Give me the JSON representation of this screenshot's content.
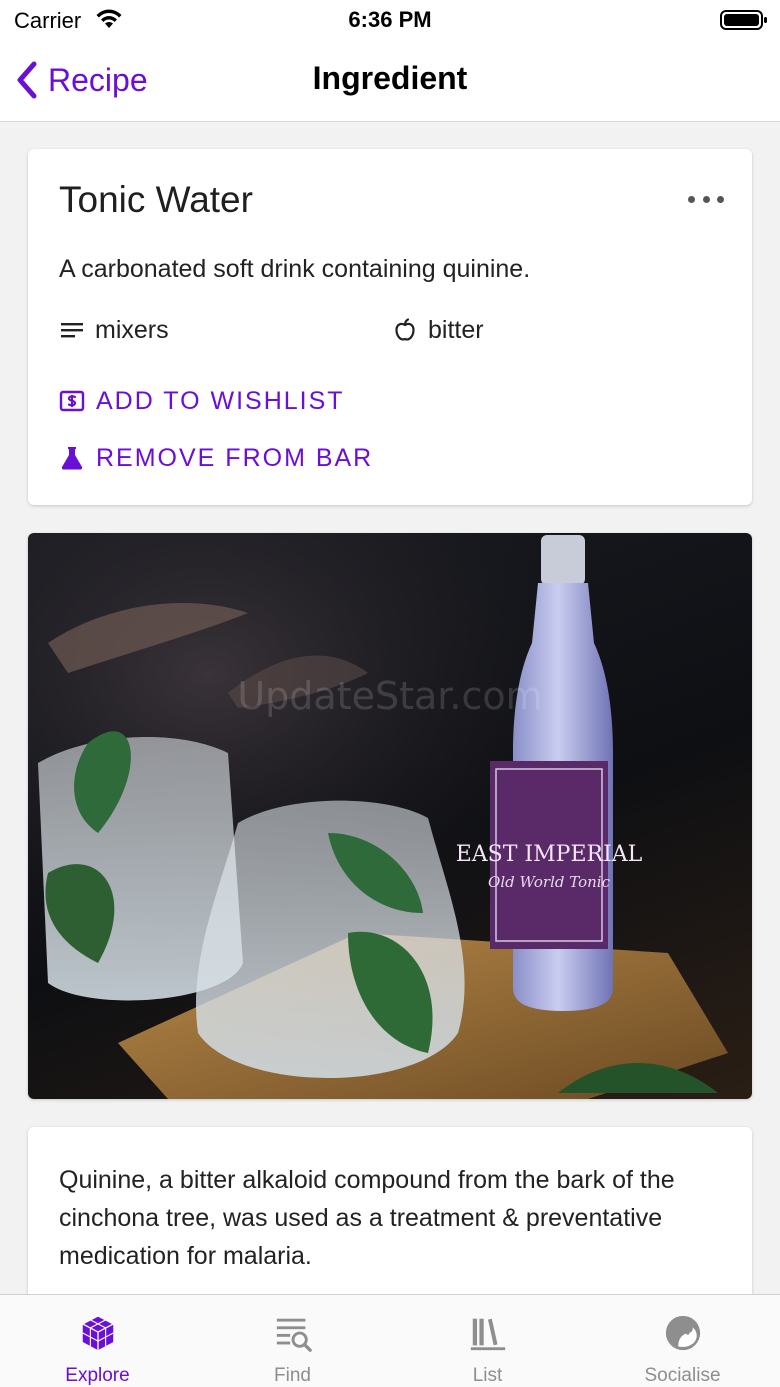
{
  "status_bar": {
    "carrier": "Carrier",
    "time": "6:36 PM"
  },
  "nav": {
    "back_label": "Recipe",
    "title": "Ingredient"
  },
  "ingredient": {
    "name": "Tonic Water",
    "description": "A carbonated soft drink containing quinine.",
    "category": "mixers",
    "flavor": "bitter",
    "actions": {
      "wishlist": "ADD TO WISHLIST",
      "remove": "REMOVE FROM BAR"
    },
    "photo_watermark": "UpdateStar.com",
    "fact": "Quinine, a bitter alkaloid compound from the bark of the cinchona tree, was used as a treatment & preventative medication for malaria."
  },
  "tabs": [
    {
      "label": "Explore",
      "icon": "cube-icon",
      "active": true
    },
    {
      "label": "Find",
      "icon": "search-list-icon",
      "active": false
    },
    {
      "label": "List",
      "icon": "library-icon",
      "active": false
    },
    {
      "label": "Socialise",
      "icon": "chat-bubble-icon",
      "active": false
    }
  ],
  "colors": {
    "accent": "#6a0fd8",
    "inactive": "#8e8e8e",
    "background": "#f2f2f2"
  }
}
